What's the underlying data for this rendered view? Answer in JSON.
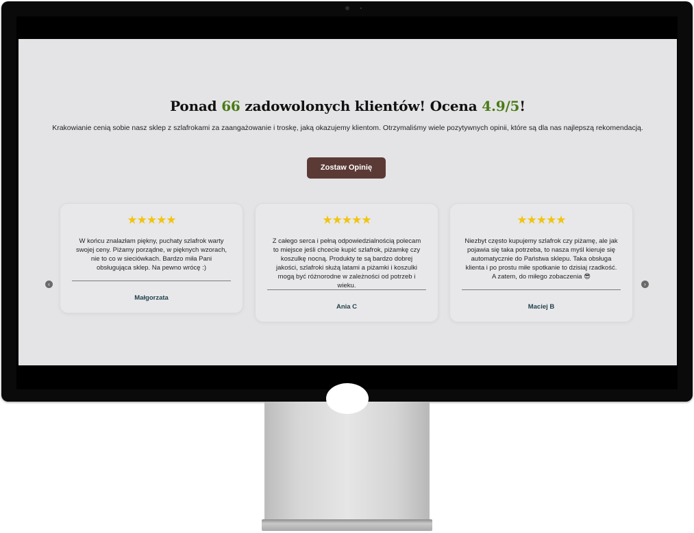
{
  "heading": {
    "prefix": "Ponad ",
    "clients_count": "66",
    "middle": " zadowolonych klientów! Ocena ",
    "rating": "4.9/5",
    "suffix": "!"
  },
  "intro": "Krakowianie cenią sobie nasz sklep z szlafrokami za zaangażowanie i troskę, jaką okazujemy klientom. Otrzymaliśmy wiele pozytywnych opinii, które są dla nas najlepszą rekomendacją.",
  "cta_label": "Zostaw Opinię",
  "stars_glyph": "★★★★★",
  "rating_stars": 5,
  "reviews": [
    {
      "text": "W końcu znalazłam piękny, puchaty szlafrok warty swojej ceny. Piżamy porządne, w pięknych wzorach, nie to co w sieciówkach. Bardzo miła Pani obsługująca sklep. Na pewno wrócę :)",
      "author": "Małgorzata"
    },
    {
      "text": "Z całego serca i pełną odpowiedzialnością polecam to miejsce jeśli chcecie kupić szlafrok, piżamkę czy koszulkę nocną. Produkty te są bardzo dobrej jakości, szlafroki służą latami a piżamki i koszulki mogą być różnorodne w zależności od potrzeb i wieku.",
      "author": "Ania C"
    },
    {
      "text": "Niezbyt często kupujemy szlafrok czy piżamę, ale jak pojawia się taka potrzeba, to nasza myśl kieruje się automatycznie do Państwa sklepu. Taka obsługa klienta i po prostu miłe spotkanie to dzisiaj rzadkość. A zatem, do miłego zobaczenia 😎",
      "author": "Maciej B"
    }
  ],
  "carousel": {
    "prev_glyph": "‹",
    "next_glyph": "›"
  },
  "colors": {
    "accent_green": "#4a7a16",
    "button_bg": "#5b3a36",
    "star": "#f1c40f",
    "author": "#1f3f4a",
    "page_bg": "#e4e4e6"
  }
}
